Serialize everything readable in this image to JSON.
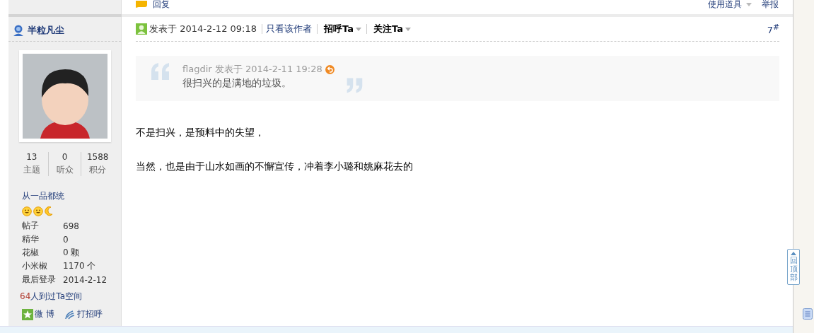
{
  "top_actions": {
    "reply": "回复",
    "tools": "使用道具",
    "report": "举报"
  },
  "author": {
    "name": "半粒凡尘",
    "stats": [
      {
        "value": "13",
        "label": "主题"
      },
      {
        "value": "0",
        "label": "听众"
      },
      {
        "value": "1588",
        "label": "积分"
      }
    ],
    "rank": "从一品都统",
    "rank_icons": [
      {
        "kind": "sun"
      },
      {
        "kind": "sun"
      },
      {
        "kind": "moon"
      }
    ],
    "fields": [
      {
        "label": "帖子",
        "value": "698"
      },
      {
        "label": "精华",
        "value": "0"
      },
      {
        "label": "花椒",
        "value": "0 颗"
      },
      {
        "label": "小米椒",
        "value": "1170 个"
      },
      {
        "label": "最后登录",
        "value": "2014-2-12"
      }
    ],
    "visits": {
      "count": "64",
      "text": "人到过Ta空间"
    },
    "links": [
      {
        "kind": "weibo",
        "label": "微 博"
      },
      {
        "kind": "greet",
        "label": "打招呼"
      }
    ]
  },
  "post": {
    "time": "发表于 2014-2-12 09:18",
    "actions": [
      {
        "label": "只看该作者",
        "dropdown": false,
        "bold": false
      },
      {
        "label": "招呼Ta",
        "dropdown": true,
        "bold": true
      },
      {
        "label": "关注Ta",
        "dropdown": true,
        "bold": true
      }
    ],
    "floor": "7$^{#}$",
    "quote": {
      "author": "flagdir",
      "time": "发表于 2014-2-11 19:28",
      "text": "很扫兴的是满地的垃圾。"
    },
    "paragraphs": [
      "不是扫兴，是预料中的失望，",
      "当然，也是由于山水如画的不懈宣传，冲着李小璐和姚麻花去的"
    ]
  },
  "back_to_top": "回顶部"
}
